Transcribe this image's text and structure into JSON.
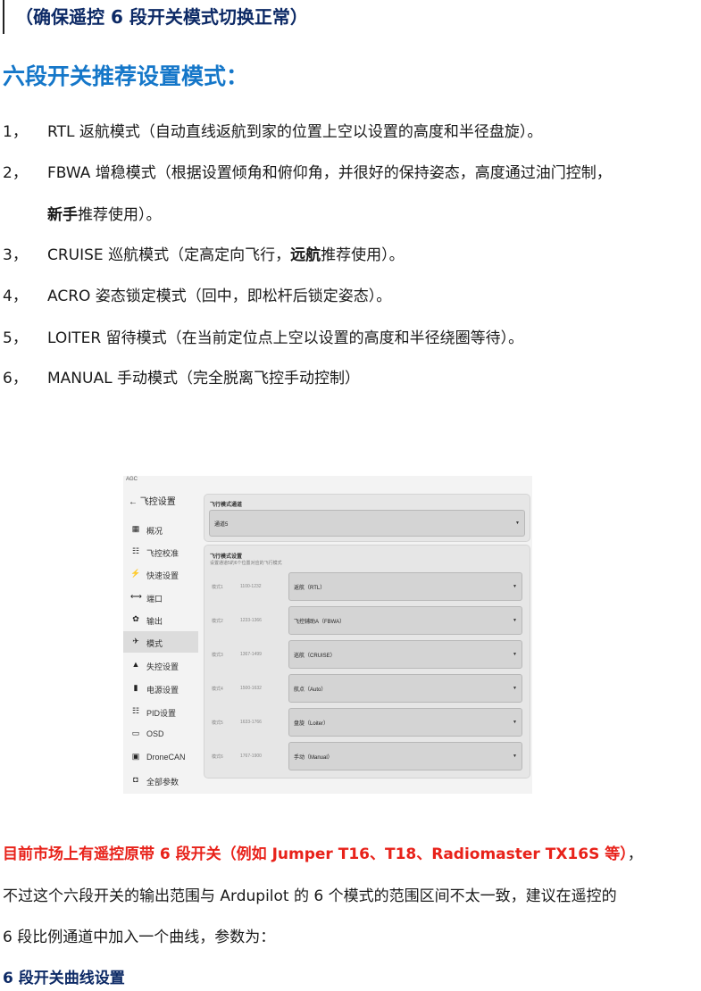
{
  "top_note": "（确保遥控 6 段开关模式切换正常）",
  "heading": "六段开关推荐设置模式：",
  "modes": [
    {
      "num": "1，",
      "text": "RTL 返航模式（自动直线返航到家的位置上空以设置的高度和半径盘旋）。"
    },
    {
      "num": "2，",
      "text": "FBWA 增稳模式（根据设置倾角和俯仰角，并很好的保持姿态，高度通过油门控制，",
      "cont_bold": "新手",
      "cont_rest": "推荐使用）。"
    },
    {
      "num": "3，",
      "pre": "CRUISE 巡航模式（定高定向飞行，",
      "bold": "远航",
      "post": "推荐使用）。"
    },
    {
      "num": "4，",
      "text": "ACRO 姿态锁定模式（回中，即松杆后锁定姿态）。"
    },
    {
      "num": "5，",
      "text": "LOITER 留待模式（在当前定位点上空以设置的高度和半径绕圈等待）。"
    },
    {
      "num": "6，",
      "text": "MANUAL  手动模式（完全脱离飞控手动控制）"
    }
  ],
  "screenshot": {
    "app_label": "AGC",
    "sidebar_title": "飞控设置",
    "sidebar_items": [
      {
        "icon": "▦",
        "label": "概况"
      },
      {
        "icon": "☷",
        "label": "飞控校准"
      },
      {
        "icon": "⚡",
        "label": "快速设置"
      },
      {
        "icon": "⟷",
        "label": "端口"
      },
      {
        "icon": "✿",
        "label": "输出"
      },
      {
        "icon": "✈",
        "label": "模式"
      },
      {
        "icon": "▲",
        "label": "失控设置"
      },
      {
        "icon": "▮",
        "label": "电源设置"
      },
      {
        "icon": "☷",
        "label": "PID设置"
      },
      {
        "icon": "▭",
        "label": "OSD"
      },
      {
        "icon": "▣",
        "label": "DroneCAN"
      },
      {
        "icon": "◘",
        "label": "全部参数"
      }
    ],
    "channel_card_title": "飞行模式通道",
    "channel_value": "通道5",
    "modes_card_title": "飞行模式设置",
    "modes_card_sub": "设置通道5的6个位置对应的飞行模式",
    "mode_rows": [
      {
        "label": "模式1",
        "range": "1100-1232",
        "value": "返航（RTL）"
      },
      {
        "label": "模式2",
        "range": "1233-1366",
        "value": "飞控辅助A（FBWA）"
      },
      {
        "label": "模式3",
        "range": "1367-1499",
        "value": "巡航（CRUISE）"
      },
      {
        "label": "模式4",
        "range": "1500-1632",
        "value": "航点（Auto）"
      },
      {
        "label": "模式5",
        "range": "1633-1766",
        "value": "盘旋（Loiter）"
      },
      {
        "label": "模式6",
        "range": "1767-1900",
        "value": "手动（Manual）"
      }
    ],
    "dropdown_arrow": "▼"
  },
  "red_text": "目前市场上有遥控原带 6 段开关（例如 Jumper T16、T18、Radiomaster TX16S 等）",
  "red_after": "，",
  "para_line1": "不过这个六段开关的输出范围与 Ardupilot 的 6 个模式的范围区间不太一致，建议在遥控的",
  "para_line2": "6 段比例通道中加入一个曲线，参数为：",
  "footer_heading": "6 段开关曲线设置"
}
